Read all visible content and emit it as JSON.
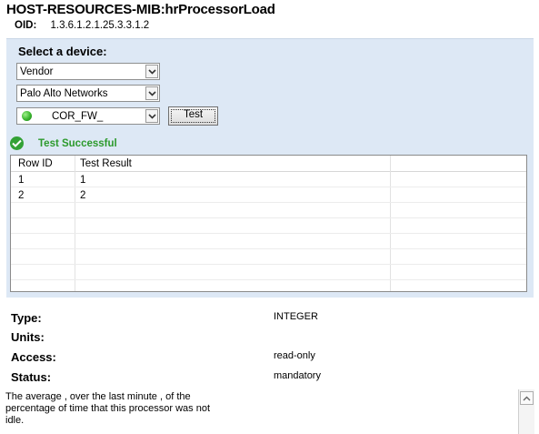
{
  "header": {
    "title": "HOST-RESOURCES-MIB:hrProcessorLoad",
    "oid_label": "OID:",
    "oid_value": "1.3.6.1.2.1.25.3.3.1.2"
  },
  "device_panel": {
    "heading": "Select a device:",
    "vendor_select": "Vendor",
    "manufacturer_select": "Palo Alto Networks",
    "device_select": "COR_FW_",
    "test_button": "Test"
  },
  "test_status": {
    "text": "Test Successful",
    "color": "#2c9a2c"
  },
  "results_table": {
    "columns": [
      "Row ID",
      "Test Result"
    ],
    "rows": [
      [
        "1",
        "1"
      ],
      [
        "2",
        "2"
      ]
    ]
  },
  "properties": {
    "type_label": "Type:",
    "type_value": "INTEGER",
    "units_label": "Units:",
    "units_value": "",
    "access_label": "Access:",
    "access_value": "read-only",
    "status_label": "Status:",
    "status_value": "mandatory"
  },
  "description": "The average , over the last minute , of the percentage of time that this processor was not idle.",
  "icons": {
    "device_status": "green-status-dot-icon",
    "success": "checkmark-icon",
    "dropdown": "chevron-down-icon",
    "scroll_up": "scroll-up-arrow-icon"
  }
}
